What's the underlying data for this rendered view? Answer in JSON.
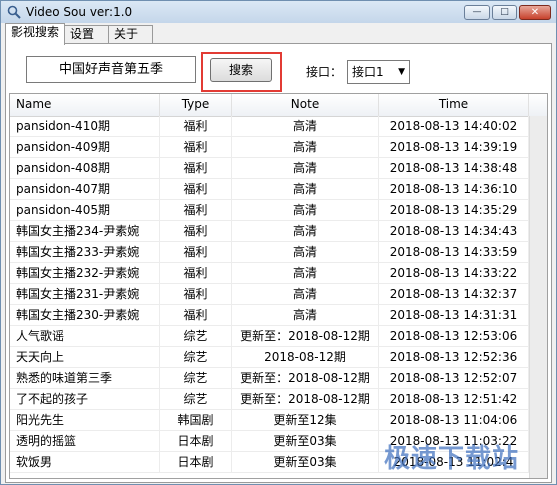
{
  "window": {
    "title": "Video Sou  ver:1.0",
    "minimize_glyph": "—",
    "maximize_glyph": "□",
    "close_glyph": "✕"
  },
  "tabs": [
    {
      "label": "影视搜索",
      "active": true
    },
    {
      "label": "设置",
      "active": false
    },
    {
      "label": "关于",
      "active": false
    }
  ],
  "search": {
    "value": "中国好声音第五季",
    "button_label": "搜索",
    "interface_label": "接口：",
    "interface_value": "接口1"
  },
  "table": {
    "columns": [
      "Name",
      "Type",
      "Note",
      "Time"
    ],
    "rows": [
      [
        "pansidon-410期",
        "福利",
        "高清",
        "2018-08-13 14:40:02"
      ],
      [
        "pansidon-409期",
        "福利",
        "高清",
        "2018-08-13 14:39:19"
      ],
      [
        "pansidon-408期",
        "福利",
        "高清",
        "2018-08-13 14:38:48"
      ],
      [
        "pansidon-407期",
        "福利",
        "高清",
        "2018-08-13 14:36:10"
      ],
      [
        "pansidon-405期",
        "福利",
        "高清",
        "2018-08-13 14:35:29"
      ],
      [
        "韩国女主播234-尹素婉",
        "福利",
        "高清",
        "2018-08-13 14:34:43"
      ],
      [
        "韩国女主播233-尹素婉",
        "福利",
        "高清",
        "2018-08-13 14:33:59"
      ],
      [
        "韩国女主播232-尹素婉",
        "福利",
        "高清",
        "2018-08-13 14:33:22"
      ],
      [
        "韩国女主播231-尹素婉",
        "福利",
        "高清",
        "2018-08-13 14:32:37"
      ],
      [
        "韩国女主播230-尹素婉",
        "福利",
        "高清",
        "2018-08-13 14:31:31"
      ],
      [
        "人气歌谣",
        "综艺",
        "更新至：2018-08-12期",
        "2018-08-13 12:53:06"
      ],
      [
        "天天向上",
        "综艺",
        "2018-08-12期",
        "2018-08-13 12:52:36"
      ],
      [
        "熟悉的味道第三季",
        "综艺",
        "更新至：2018-08-12期",
        "2018-08-13 12:52:07"
      ],
      [
        " 了不起的孩子",
        "综艺",
        "更新至：2018-08-12期",
        "2018-08-13 12:51:42"
      ],
      [
        "阳光先生",
        "韩国剧",
        "更新至12集",
        "2018-08-13 11:04:06"
      ],
      [
        "透明的摇篮",
        "日本剧",
        "更新至03集",
        "2018-08-13 11:03:22"
      ],
      [
        "软饭男",
        "日本剧",
        "更新至03集",
        "2018-08-13 11:02:4"
      ]
    ]
  },
  "watermark": "极速下载站",
  "colors": {
    "highlight_border": "#e23b34",
    "title_gradient_top": "#dbe8f5",
    "watermark": "#3c6ebe"
  }
}
